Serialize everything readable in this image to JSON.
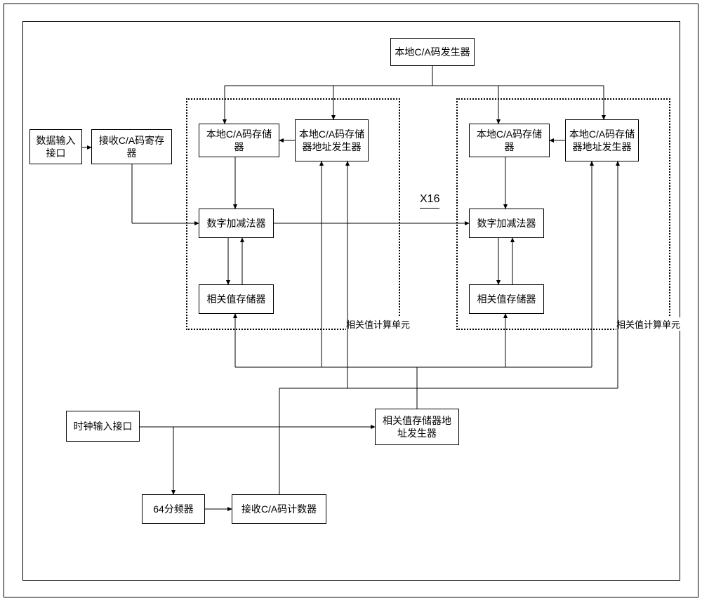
{
  "frame": {},
  "boxes": {
    "top_generator": "本地C/A码发生器",
    "data_input": "数据输入接口",
    "recv_register": "接收C/A码寄存器",
    "local_store_L": "本地C/A码存储器",
    "local_addr_gen_L": "本地C/A码存储器地址发生器",
    "local_store_R": "本地C/A码存储器",
    "local_addr_gen_R": "本地C/A码存储器地址发生器",
    "adder_L": "数字加减法器",
    "adder_R": "数字加减法器",
    "corr_store_L": "相关值存储器",
    "corr_store_R": "相关值存储器",
    "x16": "X16",
    "unit_label_L": "相关值计算单元",
    "unit_label_R": "相关值计算单元",
    "clock_input": "时钟输入接口",
    "corr_addr_gen": "相关值存储器地址发生器",
    "divider": "64分频器",
    "recv_counter": "接收C/A码计数器"
  }
}
